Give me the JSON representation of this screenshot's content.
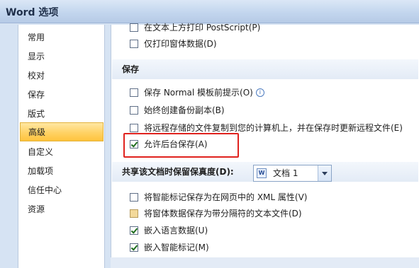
{
  "window": {
    "title": "Word 选项"
  },
  "sidebar": {
    "items": [
      {
        "label": "常用"
      },
      {
        "label": "显示"
      },
      {
        "label": "校对"
      },
      {
        "label": "保存"
      },
      {
        "label": "版式"
      },
      {
        "label": "高级",
        "selected": true
      },
      {
        "label": "自定义"
      },
      {
        "label": "加载项"
      },
      {
        "label": "信任中心"
      },
      {
        "label": "资源"
      }
    ]
  },
  "main": {
    "top_options": [
      {
        "label": "在文本上方打印 PostScript(P)",
        "checked": false
      },
      {
        "label": "仅打印窗体数据(D)",
        "checked": false
      }
    ],
    "save_section": {
      "header": "保存",
      "options": [
        {
          "label": "保存 Normal 模板前提示(O)",
          "checked": false,
          "info_icon": "info-icon"
        },
        {
          "label": "始终创建备份副本(B)",
          "checked": false
        },
        {
          "label": "将远程存储的文件复制到您的计算机上，并在保存时更新远程文件(E)",
          "checked": false
        },
        {
          "label": "允许后台保存(A)",
          "checked": true
        }
      ]
    },
    "fidelity_section": {
      "header": "共享该文档时保留保真度(D):",
      "dropdown_value": "文档 1",
      "options": [
        {
          "label": "将智能标记保存为在网页中的 XML 属性(V)",
          "checked": false
        },
        {
          "label": "将窗体数据保存为带分隔符的文本文件(D)",
          "checked": false,
          "state": "partial"
        },
        {
          "label": "嵌入语言数据(U)",
          "checked": true
        },
        {
          "label": "嵌入智能标记(M)",
          "checked": true
        }
      ]
    }
  },
  "colors": {
    "selected_sidebar": "#ffd265",
    "highlight_box": "#e0221e",
    "titlebar": "#c3d6ee"
  }
}
